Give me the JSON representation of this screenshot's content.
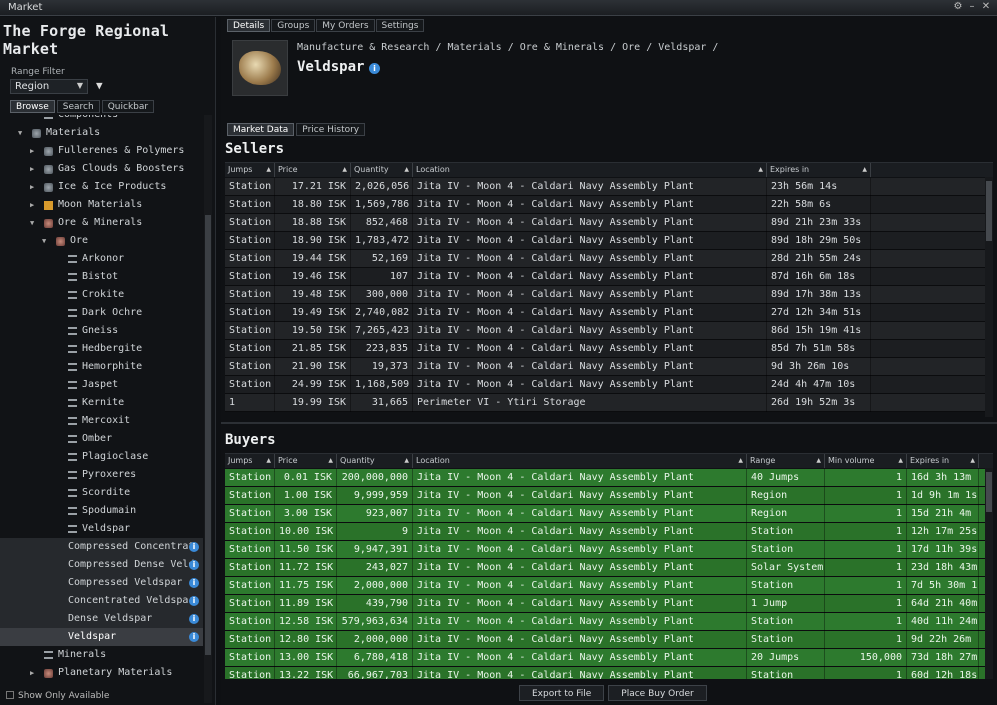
{
  "window": {
    "title": "Market"
  },
  "left": {
    "region_title": "The Forge Regional Market",
    "range_filter_label": "Range Filter",
    "range_value": "Region",
    "tabs": [
      "Browse",
      "Search",
      "Quickbar"
    ],
    "show_only_available": "Show Only Available",
    "tree": [
      {
        "label": "Components",
        "indent": 3,
        "icon": "list",
        "arrow": ""
      },
      {
        "label": "Materials",
        "indent": 2,
        "icon": "cat",
        "arrow": "▼"
      },
      {
        "label": "Fullerenes & Polymers",
        "indent": 3,
        "icon": "cat",
        "arrow": "▶"
      },
      {
        "label": "Gas Clouds & Boosters",
        "indent": 3,
        "icon": "cat",
        "arrow": "▶"
      },
      {
        "label": "Ice & Ice Products",
        "indent": 3,
        "icon": "cat",
        "arrow": "▶"
      },
      {
        "label": "Moon Materials",
        "indent": 3,
        "icon": "moon",
        "arrow": "▶"
      },
      {
        "label": "Ore & Minerals",
        "indent": 3,
        "icon": "ore",
        "arrow": "▼"
      },
      {
        "label": "Ore",
        "indent": 4,
        "icon": "ore",
        "arrow": "▼"
      },
      {
        "label": "Arkonor",
        "indent": 5,
        "icon": "list",
        "arrow": ""
      },
      {
        "label": "Bistot",
        "indent": 5,
        "icon": "list",
        "arrow": ""
      },
      {
        "label": "Crokite",
        "indent": 5,
        "icon": "list",
        "arrow": ""
      },
      {
        "label": "Dark Ochre",
        "indent": 5,
        "icon": "list",
        "arrow": ""
      },
      {
        "label": "Gneiss",
        "indent": 5,
        "icon": "list",
        "arrow": ""
      },
      {
        "label": "Hedbergite",
        "indent": 5,
        "icon": "list",
        "arrow": ""
      },
      {
        "label": "Hemorphite",
        "indent": 5,
        "icon": "list",
        "arrow": ""
      },
      {
        "label": "Jaspet",
        "indent": 5,
        "icon": "list",
        "arrow": ""
      },
      {
        "label": "Kernite",
        "indent": 5,
        "icon": "list",
        "arrow": ""
      },
      {
        "label": "Mercoxit",
        "indent": 5,
        "icon": "list",
        "arrow": ""
      },
      {
        "label": "Omber",
        "indent": 5,
        "icon": "list",
        "arrow": ""
      },
      {
        "label": "Plagioclase",
        "indent": 5,
        "icon": "list",
        "arrow": ""
      },
      {
        "label": "Pyroxeres",
        "indent": 5,
        "icon": "list",
        "arrow": ""
      },
      {
        "label": "Scordite",
        "indent": 5,
        "icon": "list",
        "arrow": ""
      },
      {
        "label": "Spodumain",
        "indent": 5,
        "icon": "list",
        "arrow": ""
      },
      {
        "label": "Veldspar",
        "indent": 5,
        "icon": "list",
        "arrow": ""
      },
      {
        "label": "Compressed Concentrat",
        "indent": 6,
        "icon": "",
        "arrow": "",
        "info": true,
        "item": true
      },
      {
        "label": "Compressed Dense Veld",
        "indent": 6,
        "icon": "",
        "arrow": "",
        "info": true,
        "item": true
      },
      {
        "label": "Compressed Veldspar",
        "indent": 6,
        "icon": "",
        "arrow": "",
        "info": true,
        "item": true
      },
      {
        "label": "Concentrated Veldspar",
        "indent": 6,
        "icon": "",
        "arrow": "",
        "info": true,
        "item": true
      },
      {
        "label": "Dense Veldspar",
        "indent": 6,
        "icon": "",
        "arrow": "",
        "info": true,
        "item": true
      },
      {
        "label": "Veldspar",
        "indent": 6,
        "icon": "",
        "arrow": "",
        "info": true,
        "item": true,
        "selected": true
      },
      {
        "label": "Minerals",
        "indent": 3,
        "icon": "list",
        "arrow": ""
      },
      {
        "label": "Planetary Materials",
        "indent": 3,
        "icon": "ore",
        "arrow": "▶"
      }
    ]
  },
  "right": {
    "top_tabs": [
      "Details",
      "Groups",
      "My Orders",
      "Settings"
    ],
    "breadcrumb": "Manufacture & Research / Materials / Ore & Minerals / Ore / Veldspar /",
    "item_title": "Veldspar",
    "sub_tabs": [
      "Market Data",
      "Price History"
    ],
    "sellers_title": "Sellers",
    "buyers_title": "Buyers",
    "sell_columns": [
      "Jumps",
      "Price",
      "Quantity",
      "Location",
      "Expires in"
    ],
    "buy_columns": [
      "Jumps",
      "Price",
      "Quantity",
      "Location",
      "Range",
      "Min volume",
      "Expires in"
    ],
    "sellers": [
      [
        "Station",
        "17.21 ISK",
        "2,026,056",
        "Jita IV - Moon 4 - Caldari Navy Assembly Plant",
        "23h 56m 14s"
      ],
      [
        "Station",
        "18.80 ISK",
        "1,569,786",
        "Jita IV - Moon 4 - Caldari Navy Assembly Plant",
        "22h 58m 6s"
      ],
      [
        "Station",
        "18.88 ISK",
        "852,468",
        "Jita IV - Moon 4 - Caldari Navy Assembly Plant",
        "89d 21h 23m 33s"
      ],
      [
        "Station",
        "18.90 ISK",
        "1,783,472",
        "Jita IV - Moon 4 - Caldari Navy Assembly Plant",
        "89d 18h 29m 50s"
      ],
      [
        "Station",
        "19.44 ISK",
        "52,169",
        "Jita IV - Moon 4 - Caldari Navy Assembly Plant",
        "28d 21h 55m 24s"
      ],
      [
        "Station",
        "19.46 ISK",
        "107",
        "Jita IV - Moon 4 - Caldari Navy Assembly Plant",
        "87d 16h 6m 18s"
      ],
      [
        "Station",
        "19.48 ISK",
        "300,000",
        "Jita IV - Moon 4 - Caldari Navy Assembly Plant",
        "89d 17h 38m 13s"
      ],
      [
        "Station",
        "19.49 ISK",
        "2,740,082",
        "Jita IV - Moon 4 - Caldari Navy Assembly Plant",
        "27d 12h 34m 51s"
      ],
      [
        "Station",
        "19.50 ISK",
        "7,265,423",
        "Jita IV - Moon 4 - Caldari Navy Assembly Plant",
        "86d 15h 19m 41s"
      ],
      [
        "Station",
        "21.85 ISK",
        "223,835",
        "Jita IV - Moon 4 - Caldari Navy Assembly Plant",
        "85d 7h 51m 58s"
      ],
      [
        "Station",
        "21.90 ISK",
        "19,373",
        "Jita IV - Moon 4 - Caldari Navy Assembly Plant",
        "9d 3h 26m 10s"
      ],
      [
        "Station",
        "24.99 ISK",
        "1,168,509",
        "Jita IV - Moon 4 - Caldari Navy Assembly Plant",
        "24d 4h 47m 10s"
      ],
      [
        "1",
        "19.99 ISK",
        "31,665",
        "Perimeter VI - Ytiri Storage",
        "26d 19h 52m 3s"
      ]
    ],
    "buyers": [
      [
        "Station",
        "0.01 ISK",
        "200,000,000",
        "Jita IV - Moon 4 - Caldari Navy Assembly Plant",
        "40 Jumps",
        "1",
        "16d 3h 13m"
      ],
      [
        "Station",
        "1.00 ISK",
        "9,999,959",
        "Jita IV - Moon 4 - Caldari Navy Assembly Plant",
        "Region",
        "1",
        "1d 9h 1m 1s"
      ],
      [
        "Station",
        "3.00 ISK",
        "923,007",
        "Jita IV - Moon 4 - Caldari Navy Assembly Plant",
        "Region",
        "1",
        "15d 21h 4m"
      ],
      [
        "Station",
        "10.00 ISK",
        "9",
        "Jita IV - Moon 4 - Caldari Navy Assembly Plant",
        "Station",
        "1",
        "12h 17m 25s"
      ],
      [
        "Station",
        "11.50 ISK",
        "9,947,391",
        "Jita IV - Moon 4 - Caldari Navy Assembly Plant",
        "Station",
        "1",
        "17d 11h 39s"
      ],
      [
        "Station",
        "11.72 ISK",
        "243,027",
        "Jita IV - Moon 4 - Caldari Navy Assembly Plant",
        "Solar System",
        "1",
        "23d 18h 43m"
      ],
      [
        "Station",
        "11.75 ISK",
        "2,000,000",
        "Jita IV - Moon 4 - Caldari Navy Assembly Plant",
        "Station",
        "1",
        "7d 5h 30m 1"
      ],
      [
        "Station",
        "11.89 ISK",
        "439,790",
        "Jita IV - Moon 4 - Caldari Navy Assembly Plant",
        "1 Jump",
        "1",
        "64d 21h 40m"
      ],
      [
        "Station",
        "12.58 ISK",
        "579,963,634",
        "Jita IV - Moon 4 - Caldari Navy Assembly Plant",
        "Station",
        "1",
        "40d 11h 24m"
      ],
      [
        "Station",
        "12.80 ISK",
        "2,000,000",
        "Jita IV - Moon 4 - Caldari Navy Assembly Plant",
        "Station",
        "1",
        "9d 22h 26m"
      ],
      [
        "Station",
        "13.00 ISK",
        "6,780,418",
        "Jita IV - Moon 4 - Caldari Navy Assembly Plant",
        "20 Jumps",
        "150,000",
        "73d 18h 27m"
      ],
      [
        "Station",
        "13.22 ISK",
        "66,967,703",
        "Jita IV - Moon 4 - Caldari Navy Assembly Plant",
        "Station",
        "1",
        "60d 12h 18s"
      ]
    ],
    "buttons": {
      "export": "Export to File",
      "place_buy": "Place Buy Order"
    }
  }
}
